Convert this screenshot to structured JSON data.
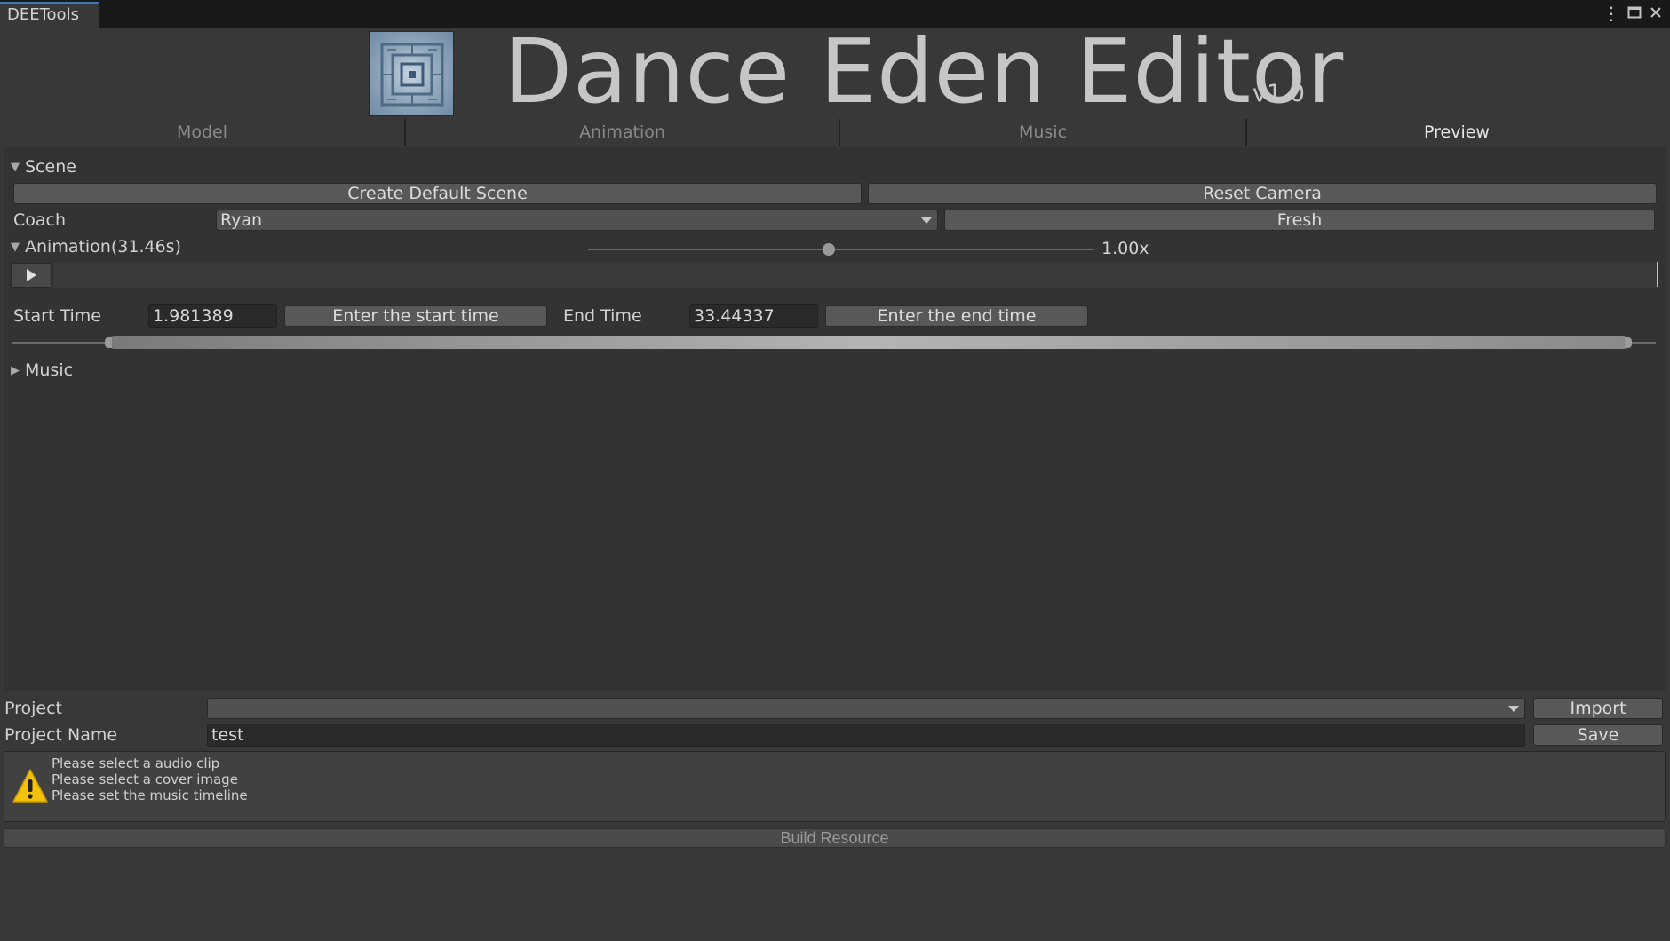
{
  "window": {
    "tab_title": "DEETools"
  },
  "header": {
    "title": "Dance Eden Editor",
    "version": "v1.0"
  },
  "tabs": [
    {
      "label": "Model"
    },
    {
      "label": "Animation"
    },
    {
      "label": "Music"
    },
    {
      "label": "Preview",
      "active": true
    }
  ],
  "scene": {
    "section_label": "Scene",
    "create_default_label": "Create Default Scene",
    "reset_camera_label": "Reset Camera",
    "coach_label": "Coach",
    "coach_value": "Ryan",
    "fresh_label": "Fresh"
  },
  "animation": {
    "section_label": "Animation(31.46s)",
    "speed_label": "1.00x",
    "speed_value": 1.0,
    "start_time_label": "Start Time",
    "start_time_value": "1.981389",
    "enter_start_label": "Enter the start time",
    "end_time_label": "End Time",
    "end_time_value": "33.44337",
    "enter_end_label": "Enter the end time"
  },
  "music": {
    "section_label": "Music"
  },
  "project": {
    "project_label": "Project",
    "project_value": "",
    "import_label": "Import",
    "name_label": "Project Name",
    "name_value": "test",
    "save_label": "Save"
  },
  "help": {
    "messages": [
      "Please select a audio clip",
      "Please select a cover image",
      "Please set the music timeline"
    ]
  },
  "build": {
    "label": "Build Resource"
  },
  "colors": {
    "background": "#383838",
    "panel": "#333333",
    "warning": "#f4c20d",
    "window_tab_accent": "#3a79bb"
  }
}
